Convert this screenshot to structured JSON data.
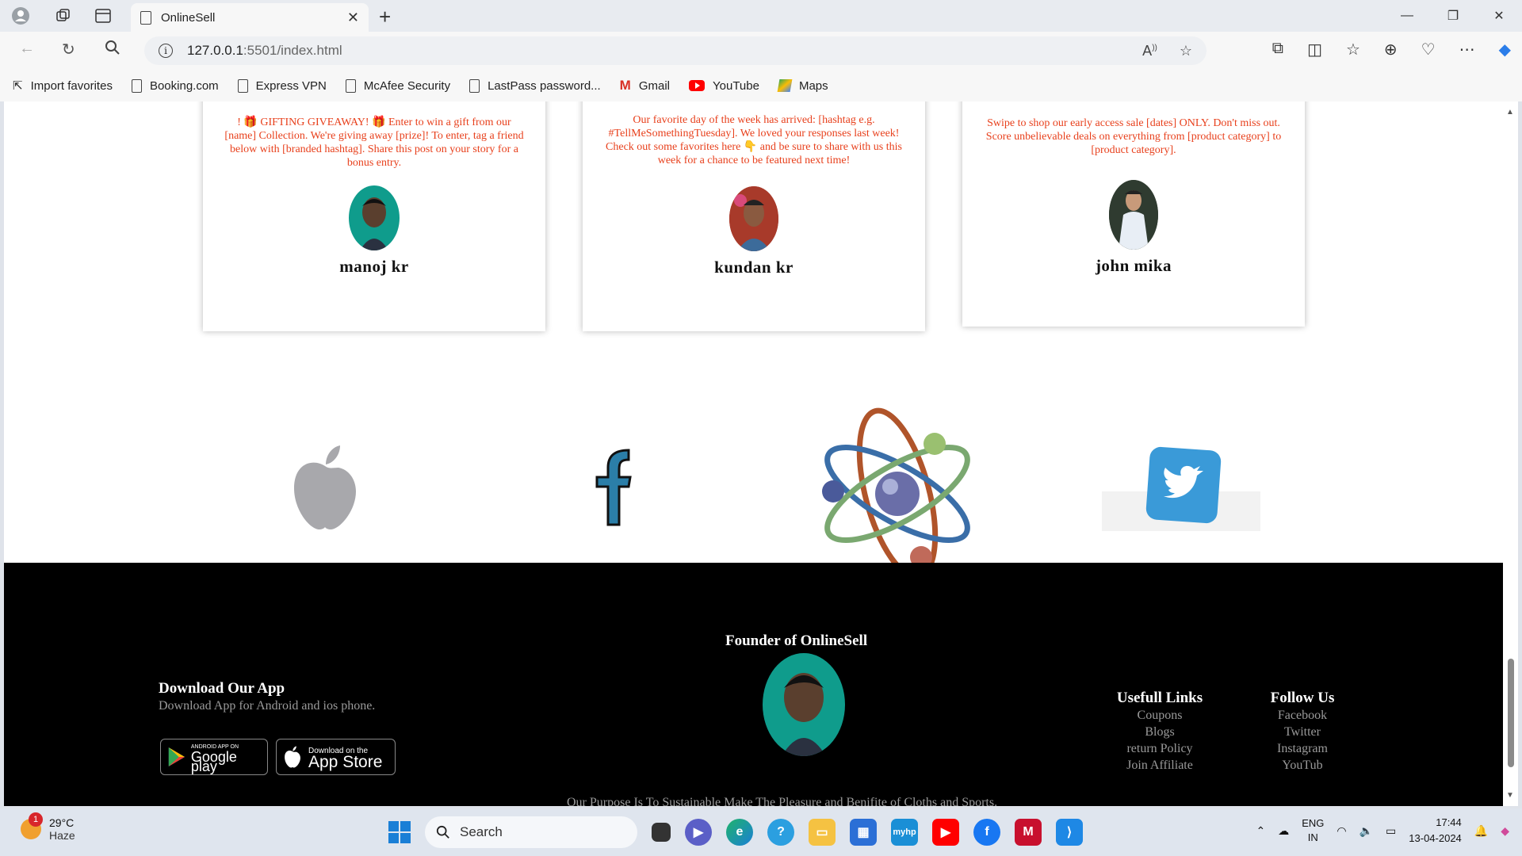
{
  "browser": {
    "tab_title": "OnlineSell",
    "url_host": "127.0.0.1",
    "url_rest": ":5501/index.html",
    "favorites": [
      {
        "label": "Import favorites"
      },
      {
        "label": "Booking.com"
      },
      {
        "label": "Express VPN"
      },
      {
        "label": "McAfee Security"
      },
      {
        "label": "LastPass password..."
      },
      {
        "label": "Gmail"
      },
      {
        "label": "YouTube"
      },
      {
        "label": "Maps"
      }
    ]
  },
  "testimonials": [
    {
      "text": "! 🎁 GIFTING GIVEAWAY! 🎁 Enter to win a gift from our [name] Collection. We're giving away [prize]! To enter, tag a friend below with [branded hashtag]. Share this post on your story for a bonus entry.",
      "name": "manoj kr",
      "avatar_color": "#0f9c8c"
    },
    {
      "text": "Our favorite day of the week has arrived: [hashtag e.g. #TellMeSomethingTuesday]. We loved your responses last week! Check out some favorites here 👇 and be sure to share with us this week for a chance to be featured next time!",
      "name": "kundan kr",
      "avatar_color": "#b33a2e"
    },
    {
      "text": "Swipe to shop our early access sale [dates] ONLY. Don't miss out. Score unbelievable deals on everything from [product category] to [product category].",
      "name": "john mika",
      "avatar_color": "#3b4a3a"
    }
  ],
  "logos": [
    "apple-logo",
    "facebook-logo",
    "atom-logo",
    "twitter-logo"
  ],
  "footer": {
    "founder_title": "Founder of OnlineSell",
    "app_heading": "Download Our App",
    "app_sub": "Download App for Android and ios phone.",
    "google_play_small": "ANDROID APP ON",
    "google_play_big": "Google play",
    "app_store_small": "Download on the",
    "app_store_big": "App Store",
    "useful_links": {
      "heading": "Usefull Links",
      "items": [
        "Coupons",
        "Blogs",
        "return Policy",
        "Join Affiliate"
      ]
    },
    "follow_us": {
      "heading": "Follow Us",
      "items": [
        "Facebook",
        "Twitter",
        "Instagram",
        "YouTub"
      ]
    },
    "purpose": "Our Purpose Is To Sustainable Make The Pleasure and Benifite of Cloths and Sports."
  },
  "taskbar": {
    "weather_temp": "29°C",
    "weather_desc": "Haze",
    "weather_badge": "1",
    "search_label": "Search",
    "lang_top": "ENG",
    "lang_bottom": "IN",
    "time": "17:44",
    "date": "13-04-2024"
  },
  "colors": {
    "testimonial_text": "#e8401c",
    "footer_bg": "#000000",
    "footer_muted": "#9a9a9a"
  }
}
